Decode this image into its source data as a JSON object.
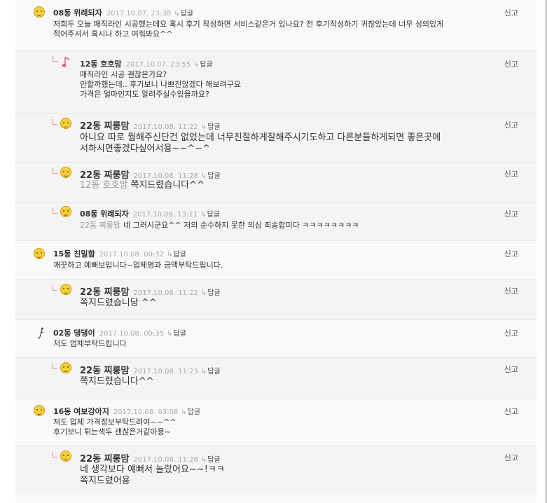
{
  "ui": {
    "reply_label": "답글",
    "report_label": "신고"
  },
  "comments": [
    {
      "author": "08동 위례되자",
      "date": "2017.10.07. 23:38",
      "avatar": "smiley-avatar-icon",
      "lines": [
        "저희두 오늘 매직라인 시공했는데요 혹시 후기 작성하면 서비스같은거 있나요? 전 후기작성하기 귀찮았는데 너무 성의있게",
        "적어주셔서 혹시나 하고 여줘봐요^^"
      ]
    },
    {
      "author": "12동 호호맘",
      "date": "2017.10.07. 23:55",
      "avatar": "music-note-avatar-icon",
      "lines": [
        "매직라인 시공 괜찮은가요?",
        "안할까했는데.. 후기보니 나쁘진않겠다 해보려구요",
        "가격은 얼마인지도 알려주실수있을까요?"
      ]
    },
    {
      "author": "22동 찌룽맘",
      "date": "2017.10.08. 11:22",
      "avatar": "smiley-avatar-icon",
      "lines": [
        "아니요 따로 뭘해주신단건 없었는데 너무친절하게잘해주시기도하고 다른분들하게되면 좋은곳에",
        "서하시면좋겠다싶어서용~~^~^"
      ]
    },
    {
      "author": "22동 찌룽맘",
      "date": "2017.10.08. 11:28",
      "avatar": "smiley-avatar-icon",
      "mention": "12동 호호맘",
      "lines": [
        "쪽지드렸습니다^^"
      ]
    },
    {
      "author": "08동 위례되자",
      "date": "2017.10.08. 13:11",
      "avatar": "smiley-avatar-icon",
      "mention": "22동 찌룽맘",
      "lines": [
        "네 그러시군요^^ 저의 순수하지 못한 의심 죄송합미다 ㅋㅋㅋㅋㅋㅋㅋㅋ"
      ]
    },
    {
      "author": "15동 친밀함",
      "date": "2017.10.08. 00:32",
      "avatar": "smiley-avatar-icon",
      "lines": [
        "깨끗하고 예뻐보입니다~업체명과 금액부탁드립니다."
      ]
    },
    {
      "author": "22동 찌룽맘",
      "date": "2017.10.08. 11:22",
      "avatar": "smiley-avatar-icon",
      "lines": [
        "쪽지드렸습니당 ^^"
      ]
    },
    {
      "author": "02동 댕댕이",
      "date": "2017.10.08. 00:35",
      "avatar": "stick-figure-avatar-icon",
      "lines": [
        "저도 업체부탁드립니다"
      ]
    },
    {
      "author": "22동 찌룽맘",
      "date": "2017.10.08. 11:23",
      "avatar": "smiley-avatar-icon",
      "lines": [
        "쪽지드렸습니다^^"
      ]
    },
    {
      "author": "16동 여보강아지",
      "date": "2017.10.08. 03:08",
      "avatar": "smiley-avatar-icon",
      "lines": [
        "저도 업체 가격정보부탁드려여~~^^",
        "후기보니 튀는색두 괜찮은거같아용~"
      ]
    },
    {
      "author": "22동 찌룽맘",
      "date": "2017.10.08. 11:26",
      "avatar": "smiley-avatar-icon",
      "lines": [
        "네 생각보다 예뻐서 놀랐어요~~!ㅋㅋ",
        "쪽지드렸어용"
      ]
    }
  ]
}
